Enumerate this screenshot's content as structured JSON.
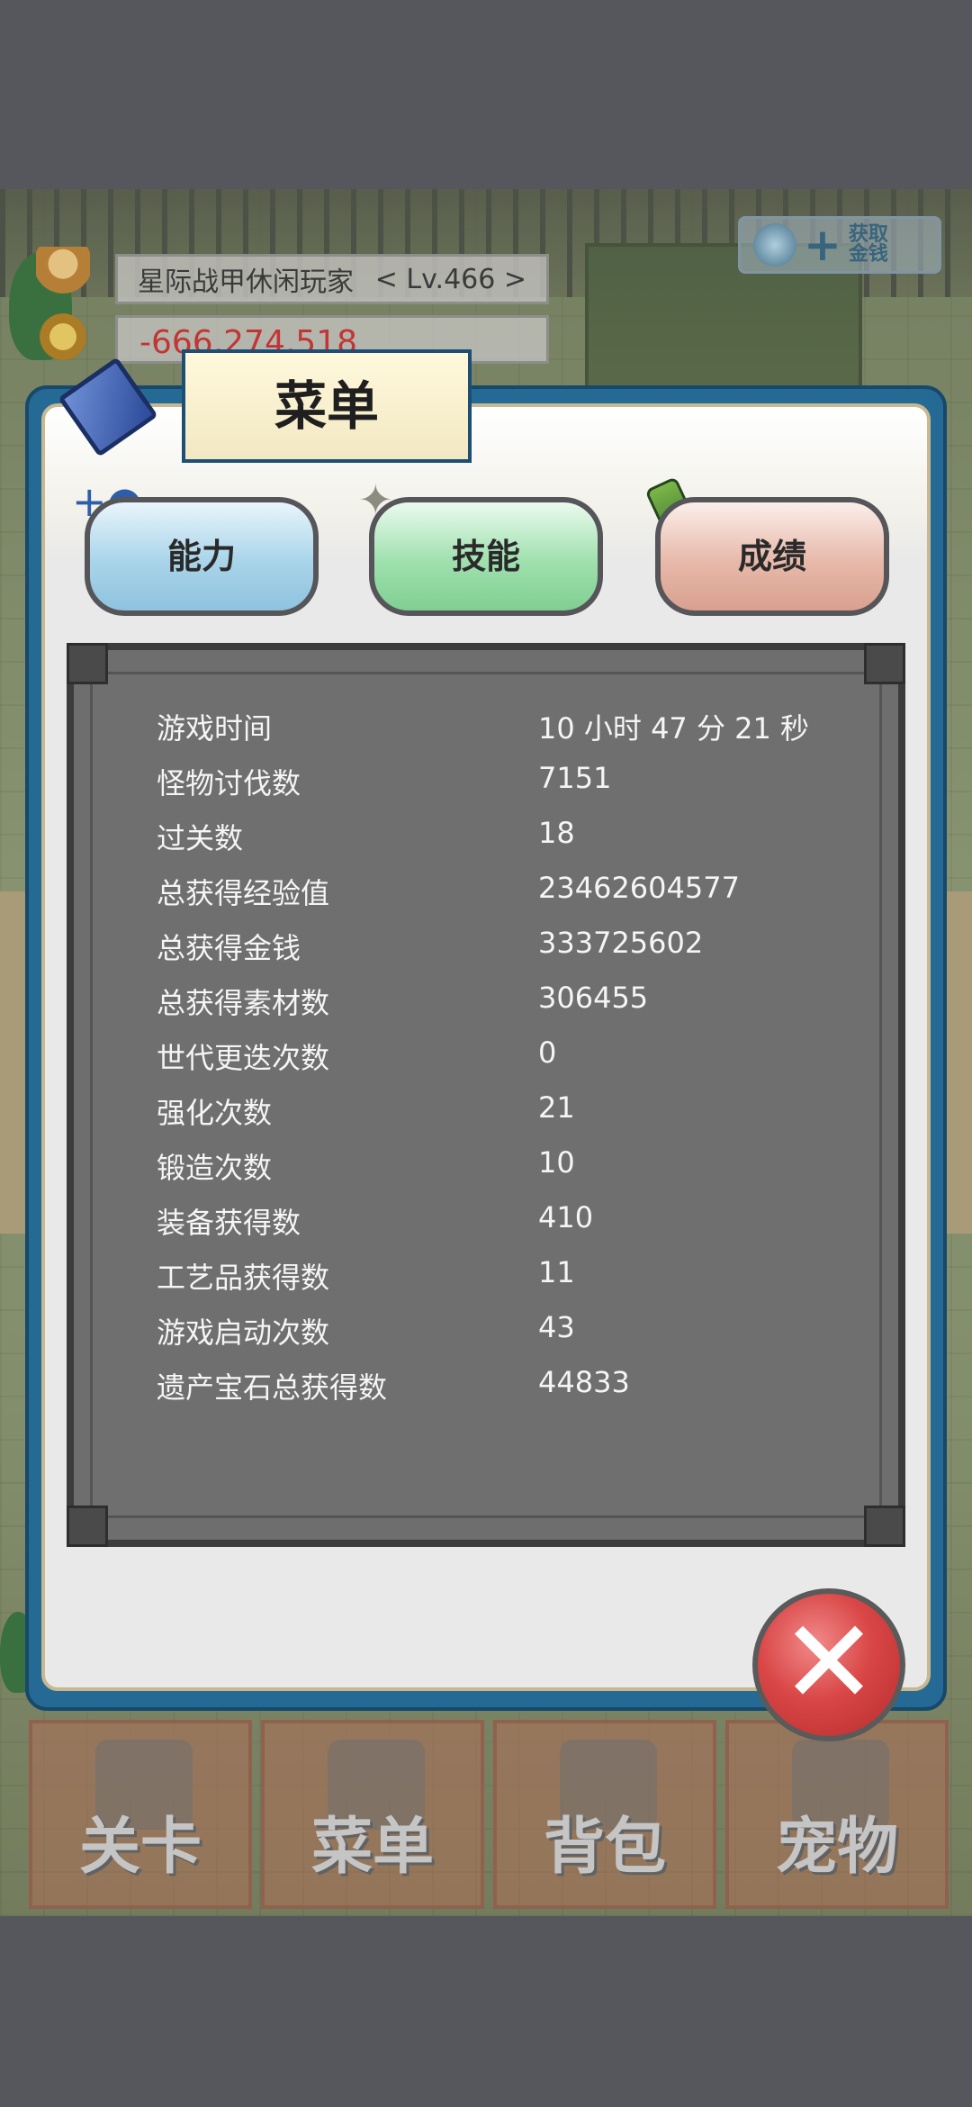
{
  "hud": {
    "player_name": "星际战甲休闲玩家",
    "level": "< Lv.466 >",
    "gold": "-666,274,518",
    "get_gold_label": "获取金钱"
  },
  "nav": [
    {
      "label": "关卡",
      "icon": "crossed-swords-icon"
    },
    {
      "label": "菜单",
      "icon": "book-icon"
    },
    {
      "label": "背包",
      "icon": "backpack-icon"
    },
    {
      "label": "宠物",
      "icon": "pet-icon"
    }
  ],
  "menu": {
    "title": "菜单",
    "tabs": [
      {
        "label": "能力",
        "icon": "person-plus-icon"
      },
      {
        "label": "技能",
        "icon": "sparkle-icon"
      },
      {
        "label": "成绩",
        "icon": "scroll-icon"
      }
    ],
    "stats": [
      {
        "label": "游戏时间",
        "value": "10 小时 47 分 21 秒"
      },
      {
        "label": "怪物讨伐数",
        "value": "7151"
      },
      {
        "label": "过关数",
        "value": "18"
      },
      {
        "label": "总获得经验值",
        "value": "23462604577"
      },
      {
        "label": "总获得金钱",
        "value": "333725602"
      },
      {
        "label": "总获得素材数",
        "value": "306455"
      },
      {
        "label": "世代更迭次数",
        "value": "0"
      },
      {
        "label": "强化次数",
        "value": "21"
      },
      {
        "label": "锻造次数",
        "value": "10"
      },
      {
        "label": "装备获得数",
        "value": "410"
      },
      {
        "label": "工艺品获得数",
        "value": "11"
      },
      {
        "label": "游戏启动次数",
        "value": "43"
      },
      {
        "label": "遗产宝石总获得数",
        "value": "44833"
      }
    ],
    "close_icon": "close-icon"
  }
}
